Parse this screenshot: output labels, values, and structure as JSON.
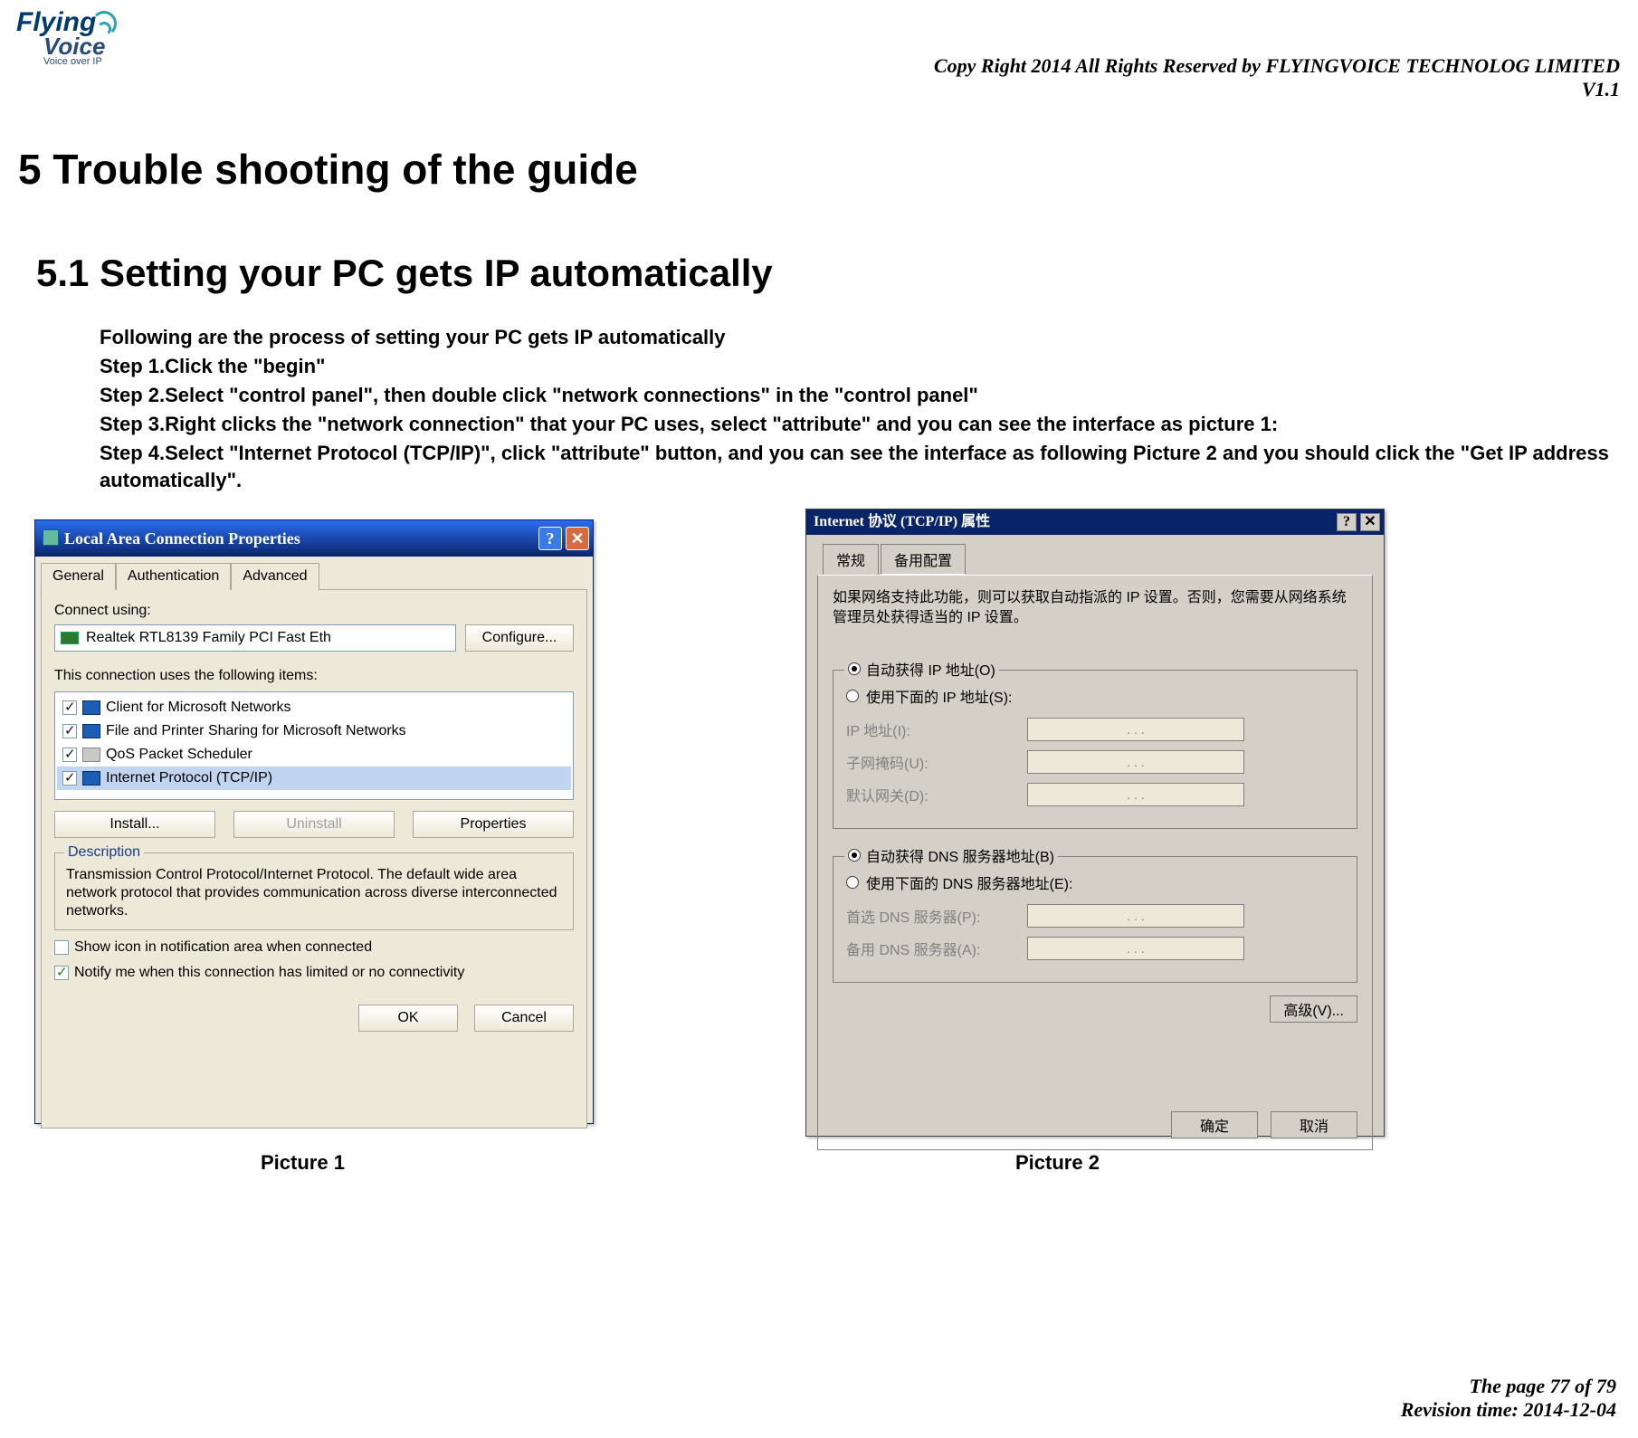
{
  "header": {
    "logo_line1": "Flying",
    "logo_line2": "Voice",
    "logo_sub": "Voice over IP",
    "copyright": "Copy Right 2014 All Rights Reserved by FLYINGVOICE TECHNOLOG LIMITED",
    "version": "V1.1"
  },
  "headings": {
    "h1": "5 Trouble shooting of the guide",
    "h2": "5.1  Setting your PC gets IP automatically"
  },
  "steps": {
    "intro": "Following are the process of setting your PC gets IP automatically",
    "s1": "Step 1.Click the \"begin\"",
    "s2": "Step 2.Select \"control panel\", then double click \"network connections\" in the \"control panel\"",
    "s3": "Step 3.Right clicks the \"network connection\" that your PC uses, select \"attribute\" and you can see the interface as picture 1:",
    "s4": "Step 4.Select \"Internet Protocol (TCP/IP)\", click \"attribute\" button, and you can see the interface as following Picture 2   and you should click the \"Get IP address automatically\"."
  },
  "picture1": {
    "title": "Local Area Connection Properties",
    "help_glyph": "?",
    "close_glyph": "✕",
    "tabs": {
      "general": "General",
      "auth": "Authentication",
      "adv": "Advanced"
    },
    "connect_using": "Connect using:",
    "adapter": "Realtek RTL8139 Family PCI Fast Eth",
    "configure": "Configure...",
    "items_label": "This connection uses the following items:",
    "items": [
      "Client for Microsoft Networks",
      "File and Printer Sharing for Microsoft Networks",
      "QoS Packet Scheduler",
      "Internet Protocol (TCP/IP)"
    ],
    "install": "Install...",
    "uninstall": "Uninstall",
    "properties": "Properties",
    "desc_legend": "Description",
    "desc_text": "Transmission Control Protocol/Internet Protocol. The default wide area network protocol that provides communication across diverse interconnected networks.",
    "show_icon": "Show icon in notification area when connected",
    "notify": "Notify me when this connection has limited or no connectivity",
    "ok": "OK",
    "cancel": "Cancel",
    "caption": "Picture 1"
  },
  "picture2": {
    "title": "Internet 协议 (TCP/IP) 属性",
    "help_glyph": "?",
    "close_glyph": "✕",
    "tabs": {
      "general": "常规",
      "alt": "备用配置"
    },
    "info": "如果网络支持此功能，则可以获取自动指派的 IP 设置。否则，您需要从网络系统管理员处获得适当的 IP 设置。",
    "auto_ip": "自动获得 IP 地址(O)",
    "manual_ip": "使用下面的 IP 地址(S):",
    "ip_label": "IP 地址(I):",
    "mask_label": "子网掩码(U):",
    "gw_label": "默认网关(D):",
    "auto_dns": "自动获得 DNS 服务器地址(B)",
    "manual_dns": "使用下面的 DNS 服务器地址(E):",
    "dns1_label": "首选 DNS 服务器(P):",
    "dns2_label": "备用 DNS 服务器(A):",
    "dots": ".     .     .",
    "advanced": "高级(V)...",
    "ok": "确定",
    "cancel": "取消",
    "caption": "Picture 2"
  },
  "footer": {
    "page": "The page 77 of 79",
    "rev": "Revision time: 2014-12-04"
  }
}
